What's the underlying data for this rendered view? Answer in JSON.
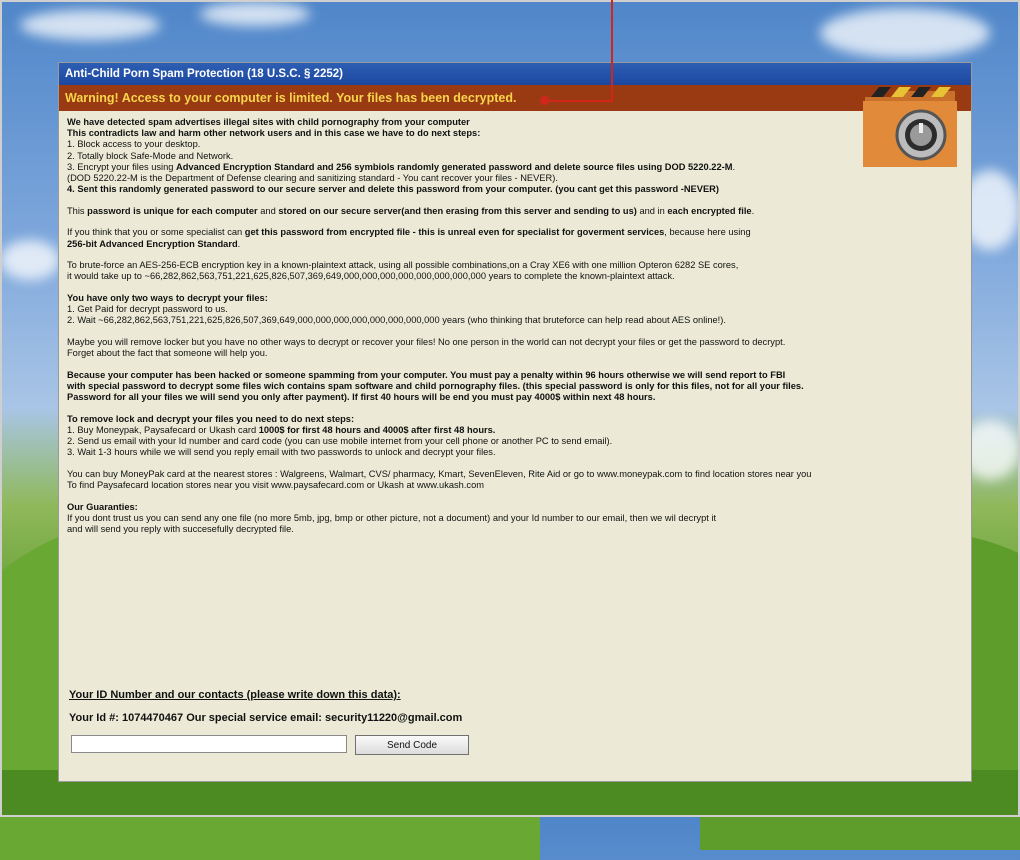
{
  "window": {
    "title": "Anti-Child Porn Spam Protection (18 U.S.C. § 2252)",
    "warning": "Warning! Access to your computer is limited. Your files has been decrypted."
  },
  "body": {
    "p1": {
      "l1": "We have detected spam advertises illegal sites with child pornography from your computer",
      "l2": "This contradicts law and harm other network users and in this case we have to do next steps:",
      "l3": "1. Block access to your desktop.",
      "l4": "2. Totally block Safe-Mode and Network.",
      "l5_a": "3. Encrypt your files using ",
      "l5_b": "Advanced Encryption Standard and 256 symbiols randomly generated password and delete source files using DOD 5220.22-M",
      "l5_c": ".",
      "l6": "(DOD 5220.22-M is the Department of Defense clearing and sanitizing standard - You cant recover your files - NEVER).",
      "l7": "4. Sent this randomly generated password to our secure server and delete this password from your computer. (you cant get this password -NEVER)"
    },
    "p2": {
      "a": "This ",
      "b": "password is unique for each computer",
      "c": " and ",
      "d": "stored on our secure server(and then erasing from this server and sending to us)",
      "e": " and in ",
      "f": "each encrypted file",
      "g": "."
    },
    "p3": {
      "a": "If you think that you or some specialist can ",
      "b": "get this password from encrypted file - this is unreal even for specialist for goverment services",
      "c": ", because here using",
      "d": "256-bit Advanced Encryption Standard",
      "e": "."
    },
    "p4": {
      "l1": "To brute-force an AES-256-ECB encryption key in a known-plaintext attack, using all possible combinations,on a Cray XE6 with one million Opteron 6282 SE cores,",
      "l2": "it would take up to ~66,282,862,563,751,221,625,826,507,369,649,000,000,000,000,000,000,000,000 years to complete the known-plaintext attack."
    },
    "p5": {
      "l1": "You have only two ways to decrypt your files:",
      "l2": "1. Get Paid for decrypt password to us.",
      "l3": "2. Wait ~66,282,862,563,751,221,625,826,507,369,649,000,000,000,000,000,000,000,000 years (who thinking that bruteforce can help read about AES online!)."
    },
    "p6": {
      "l1": "Maybe you will remove locker but  you have no other ways to decrypt or recover your files! No one person in the world can not decrypt your files or get the password to decrypt.",
      "l2": "Forget about the fact that someone will help you."
    },
    "p7": {
      "l1": "Because your computer has been hacked or someone spamming from your computer. You must pay a penalty within 96 hours otherwise we will send report to FBI",
      "l2": "with special password to decrypt some files wich contains spam software and child pornography files. (this special password is only for this files, not for all your files.",
      "l3": "Password for all your files we will send you only after payment). If first 40 hours will be end you must pay 4000$ within next 48 hours."
    },
    "p8": {
      "l1": "To remove lock and decrypt your files you need to do next steps:",
      "l2_a": "1. Buy Moneypak, Paysafecard or Ukash card ",
      "l2_b": "1000$ for first 48 hours and 4000$ after first 48 hours.",
      "l3": "2. Send us email with your Id number and card code (you can use mobile internet from your cell phone or another PC to send email).",
      "l4": "3. Wait 1-3 hours while we will send you reply email with two passwords to unlock and decrypt your files."
    },
    "p9": {
      "l1": "You can buy MoneyPak card at the nearest stores : Walgreens, Walmart, CVS/ pharmacy, Kmart, SevenEleven, Rite Aid  or go to www.moneypak.com to find location stores near you",
      "l2": "To find Paysafecard location stores near you visit www.paysafecard.com or Ukash at www.ukash.com"
    },
    "p10": {
      "l1": "Our Guaranties:",
      "l2": "If you dont trust us you can send any one file (no more 5mb, jpg, bmp or other picture, not a document) and your Id number  to our email, then we wil decrypt it",
      "l3": "and will send you reply with succesefully decrypted file."
    }
  },
  "contacts": {
    "heading": "Your ID Number and our contacts (please write down this data):",
    "id_line": "Your Id #: 1074470467 Our special service email: security11220@gmail.com"
  },
  "form": {
    "code_value": "",
    "send_label": "Send Code"
  },
  "icons": {
    "folder": "locked-folder-icon"
  },
  "colors": {
    "titlebar": "#1c47a0",
    "warnbar": "#9a3a13",
    "warn_text": "#f7d54a",
    "window_bg": "#ecead6",
    "annotation": "#d2261c"
  }
}
